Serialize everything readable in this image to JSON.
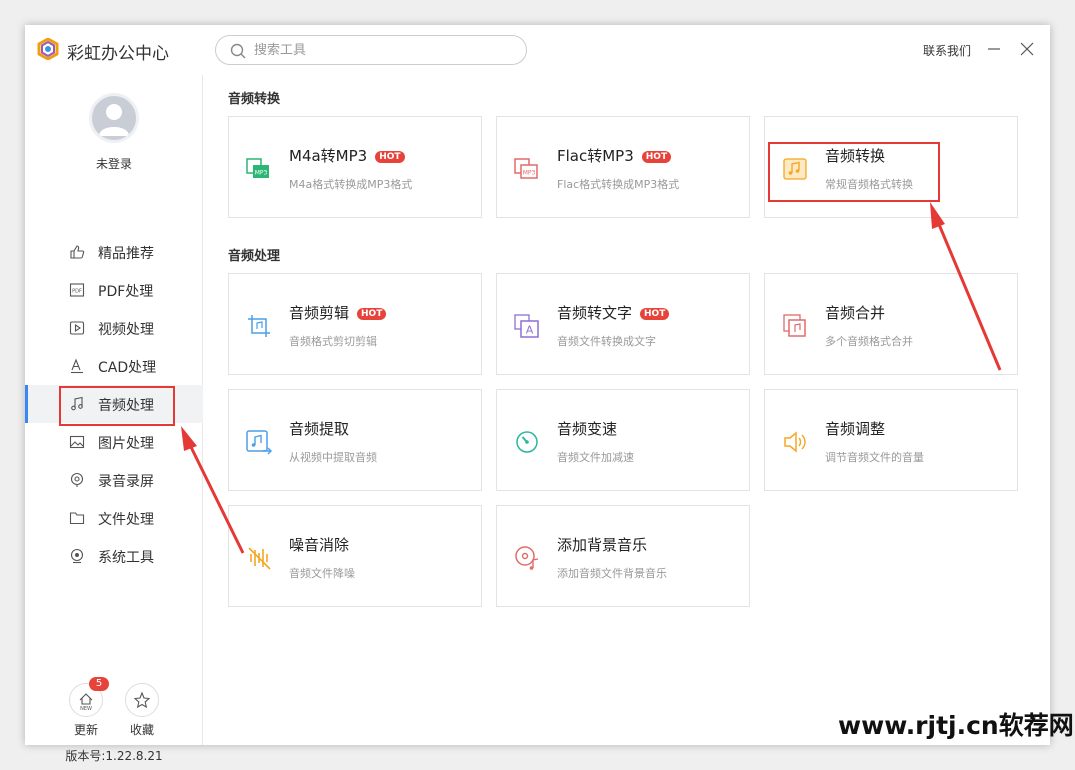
{
  "app": {
    "title": "彩虹办公中心"
  },
  "search": {
    "placeholder": "搜索工具"
  },
  "header": {
    "contact": "联系我们"
  },
  "user": {
    "status": "未登录"
  },
  "sidebar": {
    "items": [
      {
        "label": "精品推荐",
        "icon": "thumbs-up-icon"
      },
      {
        "label": "PDF处理",
        "icon": "pdf-icon"
      },
      {
        "label": "视频处理",
        "icon": "video-play-icon"
      },
      {
        "label": "CAD处理",
        "icon": "cad-icon"
      },
      {
        "label": "音频处理",
        "icon": "music-note-icon",
        "active": true
      },
      {
        "label": "图片处理",
        "icon": "image-icon"
      },
      {
        "label": "录音录屏",
        "icon": "record-icon"
      },
      {
        "label": "文件处理",
        "icon": "folder-icon"
      },
      {
        "label": "系统工具",
        "icon": "system-icon"
      }
    ],
    "update_label": "更新",
    "update_badge": "5",
    "favorite_label": "收藏",
    "version": "版本号:1.22.8.21"
  },
  "sections": [
    {
      "title": "音频转换",
      "cards": [
        {
          "title": "M4a转MP3",
          "desc": "M4a格式转换成MP3格式",
          "hot": "HOT"
        },
        {
          "title": "Flac转MP3",
          "desc": "Flac格式转换成MP3格式",
          "hot": "HOT"
        },
        {
          "title": "音频转换",
          "desc": "常规音频格式转换"
        }
      ]
    },
    {
      "title": "音频处理",
      "cards": [
        {
          "title": "音频剪辑",
          "desc": "音频格式剪切剪辑",
          "hot": "HOT"
        },
        {
          "title": "音频转文字",
          "desc": "音频文件转换成文字",
          "hot": "HOT"
        },
        {
          "title": "音频合并",
          "desc": "多个音频格式合并"
        },
        {
          "title": "音频提取",
          "desc": "从视频中提取音频"
        },
        {
          "title": "音频变速",
          "desc": "音频文件加减速"
        },
        {
          "title": "音频调整",
          "desc": "调节音频文件的音量"
        },
        {
          "title": "噪音消除",
          "desc": "音频文件降噪"
        },
        {
          "title": "添加背景音乐",
          "desc": "添加音频文件背景音乐"
        }
      ]
    }
  ],
  "watermark": "www.rjtj.cn软荐网",
  "colors": {
    "accent": "#3a86f2",
    "hot": "#e8433a",
    "annotation": "#e53935"
  }
}
